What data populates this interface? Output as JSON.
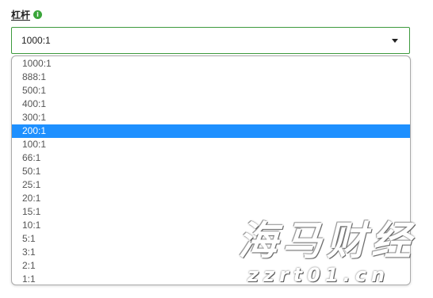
{
  "field": {
    "label": "杠杆",
    "info_icon": "i",
    "selected_value": "1000:1"
  },
  "dropdown": {
    "options": [
      "1000:1",
      "888:1",
      "500:1",
      "400:1",
      "300:1",
      "200:1",
      "100:1",
      "66:1",
      "50:1",
      "25:1",
      "20:1",
      "15:1",
      "10:1",
      "5:1",
      "3:1",
      "2:1",
      "1:1"
    ],
    "highlighted": "200:1"
  },
  "watermark": {
    "brand": "海马财经",
    "url": "zzrt01.cn"
  },
  "colors": {
    "accent_green": "#3d9a3d",
    "highlight_blue": "#1e90ff"
  }
}
